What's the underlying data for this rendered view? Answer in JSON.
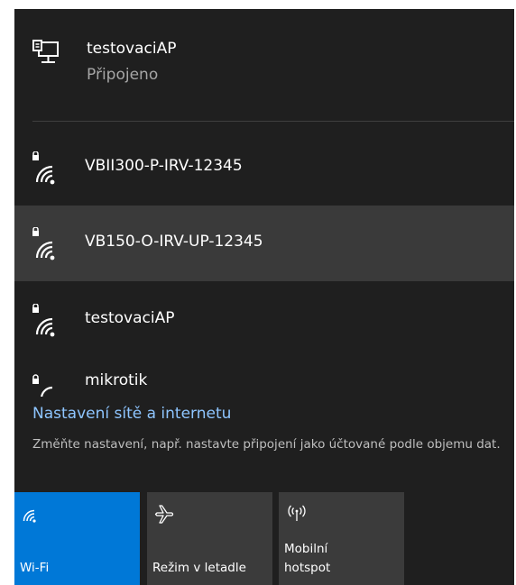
{
  "connected": {
    "name": "testovaciAP",
    "status": "Připojeno"
  },
  "networks": [
    {
      "name": "VBII300-P-IRV-12345"
    },
    {
      "name": "VB150-O-IRV-UP-12345"
    },
    {
      "name": "testovaciAP"
    },
    {
      "name": "mikrotik"
    }
  ],
  "settings": {
    "link": "Nastavení sítě a internetu",
    "description": "Změňte nastavení, např. nastavte připojení jako účtované podle objemu dat."
  },
  "tiles": [
    {
      "label": "Wi-Fi",
      "icon": "wifi-icon"
    },
    {
      "label": "Režim v letadle",
      "icon": "airplane-icon"
    },
    {
      "label": "Mobilní\nhotspot",
      "icon": "hotspot-icon"
    }
  ],
  "colors": {
    "background": "#1f1f1f",
    "hover": "#3a3a3a",
    "accent": "#0078d7",
    "link": "#8ec5ff",
    "tile": "#3b3b3b"
  }
}
